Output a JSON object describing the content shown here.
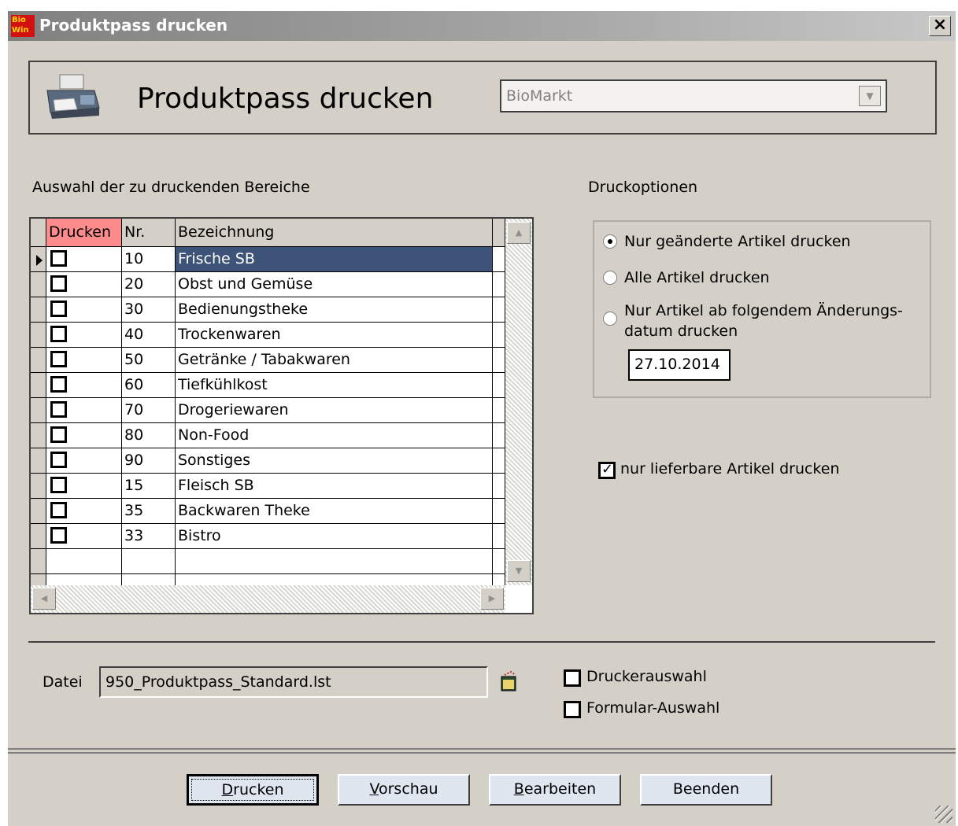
{
  "window": {
    "title": "Produktpass drucken",
    "app_badge_top": "Bio",
    "app_badge_bottom": "Win",
    "close_glyph": "×"
  },
  "header": {
    "title": "Produktpass drucken",
    "store_value": "BioMarkt",
    "store_dropdown_glyph": "▼"
  },
  "left_section": {
    "label": "Auswahl der zu druckenden Bereiche",
    "columns": [
      "Drucken",
      "Nr.",
      "Bezeichnung"
    ],
    "rows": [
      {
        "print": false,
        "nr": "10",
        "name": "Frische SB",
        "selected": true
      },
      {
        "print": false,
        "nr": "20",
        "name": "Obst und Gemüse"
      },
      {
        "print": false,
        "nr": "30",
        "name": "Bedienungstheke"
      },
      {
        "print": false,
        "nr": "40",
        "name": "Trockenwaren"
      },
      {
        "print": false,
        "nr": "50",
        "name": "Getränke / Tabakwaren"
      },
      {
        "print": false,
        "nr": "60",
        "name": "Tiefkühlkost"
      },
      {
        "print": false,
        "nr": "70",
        "name": "Drogeriewaren"
      },
      {
        "print": false,
        "nr": "80",
        "name": "Non-Food"
      },
      {
        "print": false,
        "nr": "90",
        "name": "Sonstiges"
      },
      {
        "print": false,
        "nr": "15",
        "name": "Fleisch SB"
      },
      {
        "print": false,
        "nr": "35",
        "name": "Backwaren  Theke"
      },
      {
        "print": false,
        "nr": "33",
        "name": "Bistro"
      }
    ]
  },
  "options": {
    "label": "Druckoptionen",
    "radio_1": "Nur geänderte Artikel drucken",
    "radio_2": "Alle Artikel drucken",
    "radio_3_line1": "Nur Artikel ab folgendem Änderungs-",
    "radio_3_line2": "datum drucken",
    "selected_radio": 1,
    "date": "27.10.2014",
    "deliverable_label": "nur lieferbare Artikel drucken",
    "deliverable_checked": true
  },
  "file": {
    "label": "Datei",
    "value": "950_Produktpass_Standard.lst"
  },
  "extra": {
    "printer_select_label": "Druckerauswahl",
    "printer_select_checked": false,
    "form_select_label": "Formular-Auswahl",
    "form_select_checked": false
  },
  "buttons": {
    "print_access": "D",
    "print_rest": "rucken",
    "preview_access": "V",
    "preview_rest": "orschau",
    "edit_access": "B",
    "edit_rest": "earbeiten",
    "exit": "Beenden"
  }
}
